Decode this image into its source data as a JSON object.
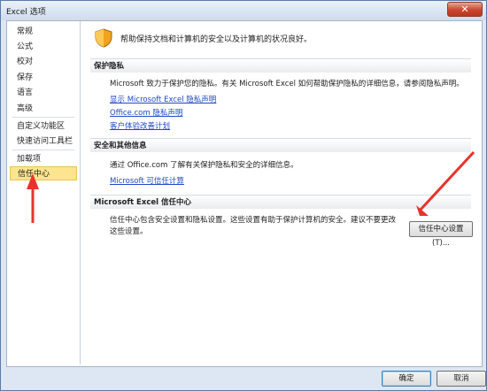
{
  "window": {
    "title": "Excel 选项",
    "close_glyph": "✕"
  },
  "sidebar": {
    "items": [
      {
        "label": "常规"
      },
      {
        "label": "公式"
      },
      {
        "label": "校对"
      },
      {
        "label": "保存"
      },
      {
        "label": "语言"
      },
      {
        "label": "高级"
      },
      {
        "label": "自定义功能区"
      },
      {
        "label": "快速访问工具栏"
      },
      {
        "label": "加载项"
      },
      {
        "label": "信任中心"
      }
    ],
    "selected": "信任中心"
  },
  "main": {
    "header_text": "帮助保持文档和计算机的安全以及计算机的状况良好。",
    "privacy": {
      "title": "保护隐私",
      "description": "Microsoft 致力于保护您的隐私。有关 Microsoft Excel 如何帮助保护隐私的详细信息，请参阅隐私声明。",
      "links": [
        "显示 Microsoft Excel 隐私声明",
        "Office.com 隐私声明",
        "客户体验改善计划"
      ]
    },
    "security_more": {
      "title": "安全和其他信息",
      "description": "通过 Office.com 了解有关保护隐私和安全的详细信息。",
      "link": "Microsoft 可信任计算"
    },
    "trust_center": {
      "title": "Microsoft Excel 信任中心",
      "description_line1": "信任中心包含安全设置和隐私设置。这些设置有助于保护计算机的安全。建议不要更改",
      "description_line2": "这些设置。",
      "button_label": "信任中心设置(T)..."
    }
  },
  "footer": {
    "ok_label": "确定",
    "cancel_label": "取消"
  },
  "colors": {
    "annotation_arrow": "#e8322d",
    "selected_bg": "#fde48f",
    "link": "#1f48c8"
  }
}
